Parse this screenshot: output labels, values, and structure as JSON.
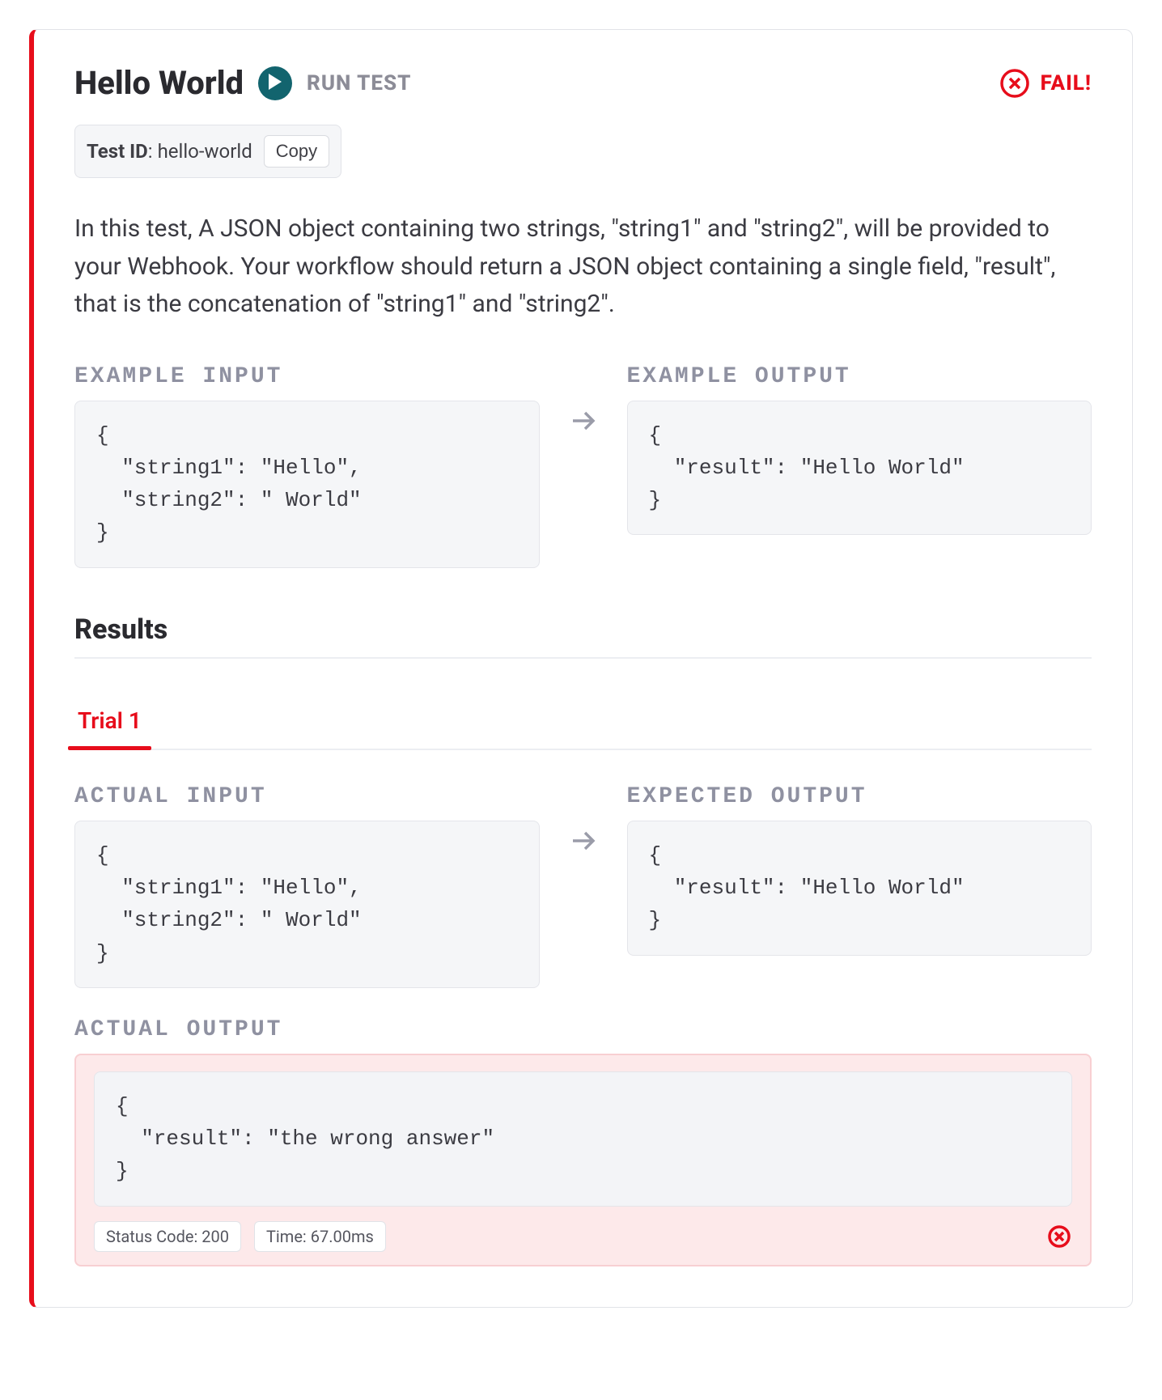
{
  "header": {
    "title": "Hello World",
    "run_label": "RUN TEST",
    "status_label": "FAIL!"
  },
  "test_id": {
    "label": "Test ID",
    "value": "hello-world",
    "copy_label": "Copy"
  },
  "description": "In this test, A JSON object containing two strings, \"string1\" and \"string2\", will be provided to your Webhook. Your workflow should return a JSON object containing a single field, \"result\", that is the concatenation of \"string1\" and \"string2\".",
  "example": {
    "input_label": "EXAMPLE INPUT",
    "output_label": "EXAMPLE OUTPUT",
    "input_code": "{\n  \"string1\": \"Hello\",\n  \"string2\": \" World\"\n}",
    "output_code": "{\n  \"result\": \"Hello World\"\n}"
  },
  "results": {
    "heading": "Results",
    "tabs": [
      {
        "label": "Trial 1",
        "active": true
      }
    ]
  },
  "trial": {
    "actual_input_label": "ACTUAL INPUT",
    "expected_output_label": "EXPECTED OUTPUT",
    "actual_output_label": "ACTUAL OUTPUT",
    "actual_input_code": "{\n  \"string1\": \"Hello\",\n  \"string2\": \" World\"\n}",
    "expected_output_code": "{\n  \"result\": \"Hello World\"\n}",
    "actual_output_code": "{\n  \"result\": \"the wrong answer\"\n}",
    "status_code_label": "Status Code: 200",
    "time_label": "Time: 67.00ms"
  },
  "colors": {
    "fail": "#e70d1b",
    "muted": "#8f91a1",
    "code_bg": "#f5f6f8"
  }
}
